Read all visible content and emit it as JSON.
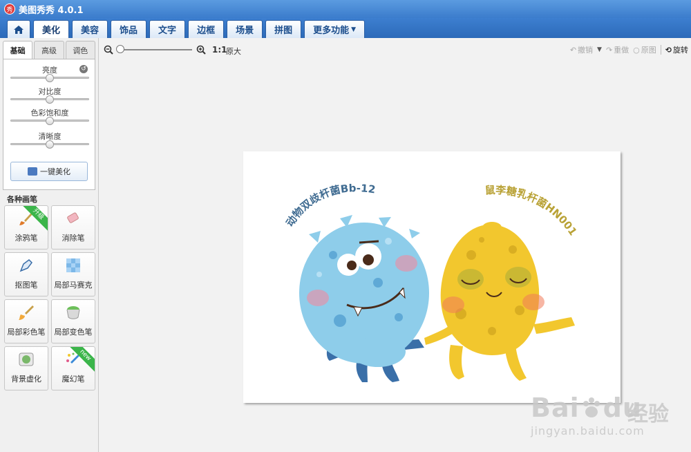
{
  "window": {
    "title": "美图秀秀 4.0.1",
    "logo_char": "秀"
  },
  "tabs": [
    {
      "label": "",
      "icon": "home-icon"
    },
    {
      "label": "美化"
    },
    {
      "label": "美容"
    },
    {
      "label": "饰品"
    },
    {
      "label": "文字"
    },
    {
      "label": "边框"
    },
    {
      "label": "场景"
    },
    {
      "label": "拼图"
    },
    {
      "label": "更多功能"
    }
  ],
  "subtabs": [
    "基础",
    "高级",
    "调色"
  ],
  "adjustments": [
    {
      "label": "亮度",
      "value": 50
    },
    {
      "label": "对比度",
      "value": 50
    },
    {
      "label": "色彩饱和度",
      "value": 50
    },
    {
      "label": "清晰度",
      "value": 50
    }
  ],
  "one_key_label": "一键美化",
  "brush_section_title": "各种画笔",
  "brushes": [
    {
      "label": "涂鸦笔",
      "badge": "升级"
    },
    {
      "label": "消除笔",
      "badge": ""
    },
    {
      "label": "抠图笔",
      "badge": ""
    },
    {
      "label": "局部马赛克",
      "badge": ""
    },
    {
      "label": "局部彩色笔",
      "badge": ""
    },
    {
      "label": "局部变色笔",
      "badge": ""
    },
    {
      "label": "背景虚化",
      "badge": ""
    },
    {
      "label": "魔幻笔",
      "badge": "new"
    }
  ],
  "toolbar": {
    "ratio": "1:1",
    "original_size": "原大",
    "undo": "撤销",
    "redo": "重做",
    "original": "原图",
    "rotate": "旋转"
  },
  "image_text": {
    "left": "动物双歧杆菌Bb-12",
    "right": "鼠李糖乳杆菌HN001"
  },
  "watermark": {
    "main": "Bai",
    "main_tail": "du",
    "cn": "经验",
    "url": "jingyan.baidu.com"
  },
  "colors": {
    "accent": "#3b7ccc",
    "blue_character": "#8ecdea",
    "yellow_character": "#f2c72e",
    "left_text": "#3f6b91",
    "right_text": "#b9a236",
    "ribbon": "#3bb54a"
  }
}
